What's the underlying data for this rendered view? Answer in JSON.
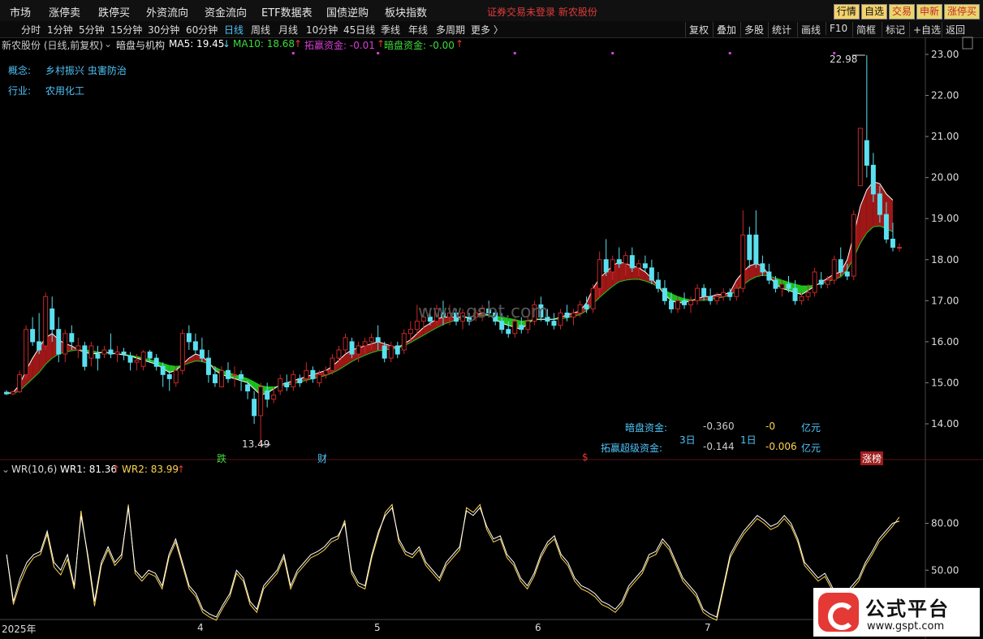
{
  "menu": {
    "items": [
      "市场",
      "涨停卖",
      "跌停买",
      "外资流向",
      "资金流向",
      "ETF数据表",
      "国债逆购",
      "板块指数"
    ],
    "notice": "证券交易未登录   新农股份",
    "right_buttons": [
      {
        "label": "行情",
        "bg": "#f5d36b",
        "fg": "#111"
      },
      {
        "label": "自选",
        "bg": "#f5d36b",
        "fg": "#111"
      },
      {
        "label": "交易",
        "bg": "#e9d66b",
        "fg": "#c62828"
      },
      {
        "label": "申新",
        "bg": "#e9d66b",
        "fg": "#c62828"
      },
      {
        "label": "涨停买",
        "bg": "#e9d66b",
        "fg": "#c62828"
      }
    ]
  },
  "periods": [
    "分时",
    "1分钟",
    "5分钟",
    "15分钟",
    "30分钟",
    "60分钟",
    "日线",
    "周线",
    "月线",
    "10分钟",
    "45日线",
    "季线",
    "年线",
    "多周期",
    "更多 〉"
  ],
  "active_period": "日线",
  "right_tools": [
    "复权",
    "叠加",
    "多股",
    "统计",
    "画线",
    "F10",
    "简框",
    "标记",
    "+自选",
    "返回"
  ],
  "title_line": {
    "stock": "新农股份 (日线,前复权)",
    "indicator": "暗盘与机构",
    "ma5": "MA5: 19.45",
    "ma10": "MA10: 18.68",
    "tuoying": "拓赢资金: -0.01",
    "anpan": "暗盘资金: -0.00"
  },
  "concept_label": "概念:",
  "concept_value": "乡村振兴  虫害防治",
  "industry_label": "行业:",
  "industry_value": "农用化工",
  "price_axis": [
    "23.00",
    "22.00",
    "21.00",
    "20.00",
    "19.00",
    "18.00",
    "17.00",
    "16.00",
    "15.00",
    "14.00"
  ],
  "high_label": "22.98",
  "low_label": "13.49",
  "watermark": "www.gsbt.com",
  "event_marks": {
    "die": "跌",
    "cai": "财",
    "s": "$",
    "zhang": "涨榜"
  },
  "fund_table": {
    "anpan_label": "暗盘资金:",
    "anpan_3d": "-0.360",
    "anpan_1d": "-0",
    "unit1": "亿元",
    "d3": "3日",
    "d1": "1日",
    "tuoying_label": "拓赢超级资金:",
    "tuoying_3d": "-0.144",
    "tuoying_1d": "-0.006",
    "unit2": "亿元"
  },
  "wr_line": {
    "name": "WR(10,6)",
    "wr1": "WR1: 81.36",
    "wr2": "WR2: 83.99"
  },
  "wr_axis": [
    "80.00",
    "50.00"
  ],
  "date_axis": [
    "2025年",
    "4",
    "5",
    "6",
    "7"
  ],
  "logo": {
    "title": "公式平台",
    "url": "www.gspt.com"
  },
  "colors": {
    "up": "#c62828",
    "down": "#5be0f0",
    "ma5": "#ffffff",
    "ma10": "#ffd54f",
    "band_green": "#1ec81e",
    "band_red": "#a51818",
    "wr1": "#ffffff",
    "wr2": "#ffd54f"
  },
  "chart_data": {
    "type": "candlestick",
    "ylim": [
      13.2,
      23.2
    ],
    "candles": [
      [
        14.77,
        14.82,
        14.7,
        14.73
      ],
      [
        14.73,
        14.8,
        14.7,
        14.78
      ],
      [
        14.78,
        15.3,
        14.75,
        15.2
      ],
      [
        15.2,
        16.4,
        15.1,
        16.3
      ],
      [
        16.3,
        16.6,
        15.9,
        16.0
      ],
      [
        16.0,
        16.7,
        15.7,
        15.8
      ],
      [
        15.9,
        17.2,
        15.8,
        17.1
      ],
      [
        16.8,
        17.1,
        16.0,
        16.3
      ],
      [
        16.3,
        16.6,
        15.5,
        15.7
      ],
      [
        15.7,
        16.3,
        15.5,
        16.2
      ],
      [
        16.2,
        16.4,
        15.8,
        16.0
      ],
      [
        15.8,
        16.1,
        15.6,
        15.9
      ],
      [
        15.9,
        16.0,
        15.3,
        15.4
      ],
      [
        15.6,
        16.0,
        15.4,
        15.9
      ],
      [
        15.7,
        15.9,
        15.3,
        15.6
      ],
      [
        15.7,
        15.9,
        15.6,
        15.8
      ],
      [
        15.8,
        16.2,
        15.6,
        15.7
      ],
      [
        15.7,
        15.9,
        15.5,
        15.75
      ],
      [
        15.75,
        15.85,
        15.55,
        15.7
      ],
      [
        15.65,
        15.75,
        15.3,
        15.5
      ],
      [
        15.5,
        15.7,
        15.3,
        15.55
      ],
      [
        15.4,
        15.8,
        15.3,
        15.75
      ],
      [
        15.75,
        15.8,
        15.5,
        15.6
      ],
      [
        15.6,
        15.7,
        15.3,
        15.4
      ],
      [
        15.4,
        15.5,
        14.9,
        15.2
      ],
      [
        15.2,
        15.3,
        14.8,
        15.1
      ],
      [
        15.0,
        15.4,
        14.9,
        15.3
      ],
      [
        15.3,
        16.3,
        15.2,
        16.2
      ],
      [
        16.2,
        16.4,
        15.8,
        16.0
      ],
      [
        16.0,
        16.2,
        15.7,
        15.8
      ],
      [
        15.8,
        16.1,
        15.5,
        15.6
      ],
      [
        15.6,
        15.8,
        15.0,
        15.2
      ],
      [
        15.2,
        15.4,
        14.9,
        15.0
      ],
      [
        14.9,
        15.4,
        14.9,
        15.3
      ],
      [
        15.3,
        15.5,
        15.0,
        15.1
      ],
      [
        15.2,
        15.4,
        14.9,
        15.2
      ],
      [
        15.2,
        15.3,
        14.8,
        15.1
      ],
      [
        14.95,
        15.05,
        14.6,
        14.8
      ],
      [
        14.6,
        14.8,
        14.0,
        14.2
      ],
      [
        14.2,
        15.0,
        13.49,
        14.9
      ],
      [
        14.8,
        15.0,
        14.4,
        14.6
      ],
      [
        14.6,
        14.9,
        14.5,
        14.7
      ],
      [
        14.8,
        15.2,
        14.7,
        15.1
      ],
      [
        15.0,
        15.2,
        14.8,
        14.9
      ],
      [
        14.9,
        15.3,
        14.8,
        15.2
      ],
      [
        15.1,
        15.2,
        14.9,
        15.0
      ],
      [
        15.1,
        15.5,
        15.0,
        15.3
      ],
      [
        15.3,
        15.4,
        15.0,
        15.1
      ],
      [
        15.0,
        15.3,
        14.9,
        15.2
      ],
      [
        15.2,
        15.4,
        15.1,
        15.3
      ],
      [
        15.3,
        15.7,
        15.2,
        15.6
      ],
      [
        15.6,
        15.9,
        15.5,
        15.8
      ],
      [
        15.8,
        16.2,
        15.7,
        16.1
      ],
      [
        16.0,
        16.1,
        15.6,
        15.7
      ],
      [
        15.7,
        16.0,
        15.5,
        15.9
      ],
      [
        15.9,
        16.1,
        15.7,
        16.0
      ],
      [
        16.0,
        16.2,
        15.8,
        16.1
      ],
      [
        16.1,
        16.4,
        15.8,
        16.0
      ],
      [
        15.9,
        16.0,
        15.5,
        15.6
      ],
      [
        15.6,
        16.0,
        15.5,
        15.9
      ],
      [
        15.9,
        16.0,
        15.6,
        15.7
      ],
      [
        15.8,
        16.3,
        15.7,
        16.2
      ],
      [
        16.2,
        16.5,
        16.0,
        16.3
      ],
      [
        16.3,
        16.9,
        16.2,
        16.5
      ],
      [
        16.5,
        16.8,
        16.3,
        16.6
      ],
      [
        16.6,
        16.8,
        16.4,
        16.5
      ],
      [
        16.5,
        16.9,
        16.4,
        16.8
      ],
      [
        16.7,
        17.0,
        16.4,
        16.6
      ],
      [
        16.6,
        16.9,
        16.4,
        16.7
      ],
      [
        16.7,
        16.8,
        16.4,
        16.5
      ],
      [
        16.5,
        16.8,
        16.3,
        16.7
      ],
      [
        16.6,
        16.7,
        16.4,
        16.5
      ],
      [
        16.6,
        16.8,
        16.5,
        16.7
      ],
      [
        16.7,
        16.9,
        16.5,
        16.8
      ],
      [
        16.8,
        17.0,
        16.6,
        16.7
      ],
      [
        16.7,
        16.8,
        16.4,
        16.5
      ],
      [
        16.5,
        16.7,
        16.2,
        16.3
      ],
      [
        16.3,
        16.5,
        16.1,
        16.2
      ],
      [
        16.2,
        16.6,
        16.1,
        16.5
      ],
      [
        16.4,
        16.6,
        16.2,
        16.3
      ],
      [
        16.3,
        16.6,
        16.2,
        16.5
      ],
      [
        16.5,
        17.0,
        16.4,
        16.9
      ],
      [
        16.9,
        17.1,
        16.5,
        16.6
      ],
      [
        16.6,
        16.8,
        16.4,
        16.5
      ],
      [
        16.5,
        16.7,
        16.3,
        16.4
      ],
      [
        16.4,
        16.8,
        16.3,
        16.7
      ],
      [
        16.7,
        16.9,
        16.5,
        16.6
      ],
      [
        16.6,
        16.8,
        16.4,
        16.7
      ],
      [
        16.7,
        17.0,
        16.6,
        16.9
      ],
      [
        16.9,
        17.1,
        16.7,
        16.8
      ],
      [
        16.8,
        17.4,
        16.7,
        17.3
      ],
      [
        17.3,
        18.2,
        17.1,
        18.0
      ],
      [
        18.0,
        18.5,
        17.6,
        17.7
      ],
      [
        17.7,
        18.1,
        17.5,
        18.0
      ],
      [
        18.0,
        18.3,
        17.8,
        17.9
      ],
      [
        17.9,
        18.2,
        17.6,
        18.1
      ],
      [
        18.1,
        18.3,
        17.7,
        17.8
      ],
      [
        17.8,
        18.0,
        17.6,
        17.9
      ],
      [
        17.9,
        18.1,
        17.7,
        17.8
      ],
      [
        17.8,
        18.0,
        17.4,
        17.5
      ],
      [
        17.5,
        17.7,
        17.2,
        17.3
      ],
      [
        17.3,
        17.5,
        16.9,
        17.0
      ],
      [
        17.0,
        17.2,
        16.7,
        16.8
      ],
      [
        16.8,
        17.1,
        16.7,
        17.0
      ],
      [
        17.0,
        17.2,
        16.8,
        16.9
      ],
      [
        16.9,
        17.1,
        16.7,
        17.0
      ],
      [
        17.0,
        17.4,
        16.9,
        17.3
      ],
      [
        17.3,
        17.4,
        17.0,
        17.1
      ],
      [
        17.1,
        17.3,
        16.9,
        17.0
      ],
      [
        17.0,
        17.2,
        16.9,
        17.1
      ],
      [
        17.1,
        17.3,
        17.0,
        17.2
      ],
      [
        17.2,
        17.3,
        17.0,
        17.1
      ],
      [
        17.1,
        17.4,
        17.0,
        17.3
      ],
      [
        17.3,
        19.2,
        17.2,
        18.6
      ],
      [
        18.6,
        18.8,
        17.8,
        18.0
      ],
      [
        18.6,
        19.2,
        17.8,
        17.9
      ],
      [
        17.9,
        18.1,
        17.6,
        17.7
      ],
      [
        17.7,
        17.9,
        17.4,
        17.5
      ],
      [
        17.5,
        17.6,
        17.2,
        17.3
      ],
      [
        17.3,
        17.5,
        17.1,
        17.4
      ],
      [
        17.4,
        17.6,
        17.2,
        17.3
      ],
      [
        17.3,
        17.5,
        16.9,
        17.0
      ],
      [
        17.0,
        17.2,
        16.9,
        17.1
      ],
      [
        17.1,
        17.4,
        17.0,
        17.2
      ],
      [
        17.2,
        17.8,
        17.1,
        17.7
      ],
      [
        17.5,
        17.7,
        17.3,
        17.4
      ],
      [
        17.4,
        17.6,
        17.3,
        17.5
      ],
      [
        17.5,
        18.1,
        17.4,
        18.0
      ],
      [
        18.0,
        18.3,
        17.6,
        17.7
      ],
      [
        17.7,
        17.9,
        17.5,
        17.6
      ],
      [
        17.6,
        19.2,
        17.5,
        19.1
      ],
      [
        19.8,
        21.2,
        19.8,
        21.2
      ],
      [
        20.9,
        22.98,
        20.0,
        20.3
      ],
      [
        20.3,
        20.6,
        19.4,
        19.6
      ],
      [
        19.6,
        19.8,
        18.9,
        19.1
      ],
      [
        19.1,
        19.4,
        18.4,
        18.5
      ],
      [
        18.5,
        18.9,
        18.2,
        18.3
      ],
      [
        18.3,
        18.4,
        18.2,
        18.3
      ]
    ],
    "ma5": [
      14.75,
      14.76,
      14.95,
      15.3,
      15.6,
      15.85,
      16.1,
      16.2,
      16.05,
      15.95,
      15.9,
      15.8,
      15.75,
      15.7,
      15.72,
      15.75,
      15.72,
      15.7,
      15.68,
      15.65,
      15.6,
      15.55,
      15.5,
      15.45,
      15.35,
      15.25,
      15.3,
      15.45,
      15.6,
      15.7,
      15.65,
      15.5,
      15.3,
      15.2,
      15.15,
      15.1,
      15.05,
      15.0,
      14.85,
      14.7,
      14.75,
      14.85,
      14.95,
      15.0,
      15.05,
      15.1,
      15.15,
      15.2,
      15.25,
      15.3,
      15.4,
      15.55,
      15.7,
      15.8,
      15.85,
      15.9,
      15.95,
      16.0,
      15.95,
      15.9,
      15.85,
      15.95,
      16.05,
      16.2,
      16.35,
      16.45,
      16.55,
      16.6,
      16.6,
      16.6,
      16.6,
      16.6,
      16.65,
      16.7,
      16.65,
      16.55,
      16.45,
      16.4,
      16.35,
      16.3,
      16.45,
      16.55,
      16.55,
      16.55,
      16.55,
      16.6,
      16.65,
      16.7,
      16.75,
      16.95,
      17.3,
      17.55,
      17.7,
      17.85,
      17.95,
      17.9,
      17.85,
      17.8,
      17.7,
      17.55,
      17.35,
      17.15,
      17.0,
      16.95,
      16.95,
      17.0,
      17.05,
      17.1,
      17.1,
      17.15,
      17.15,
      17.2,
      17.5,
      17.7,
      17.85,
      17.9,
      17.85,
      17.6,
      17.4,
      17.3,
      17.25,
      17.2,
      17.15,
      17.25,
      17.35,
      17.45,
      17.55,
      17.65,
      17.7,
      18.0,
      18.6,
      19.3,
      19.7,
      19.9,
      19.85,
      19.6,
      19.45
    ],
    "ma10": [
      14.74,
      14.74,
      14.8,
      14.95,
      15.1,
      15.25,
      15.45,
      15.6,
      15.7,
      15.75,
      15.78,
      15.8,
      15.8,
      15.78,
      15.75,
      15.73,
      15.72,
      15.71,
      15.69,
      15.67,
      15.64,
      15.6,
      15.56,
      15.52,
      15.47,
      15.42,
      15.4,
      15.42,
      15.48,
      15.53,
      15.52,
      15.46,
      15.38,
      15.3,
      15.25,
      15.2,
      15.15,
      15.1,
      15.02,
      14.93,
      14.9,
      14.9,
      14.92,
      14.95,
      14.98,
      15.02,
      15.06,
      15.1,
      15.14,
      15.18,
      15.24,
      15.32,
      15.42,
      15.52,
      15.6,
      15.67,
      15.73,
      15.78,
      15.8,
      15.82,
      15.84,
      15.9,
      15.98,
      16.07,
      16.16,
      16.25,
      16.34,
      16.42,
      16.48,
      16.53,
      16.57,
      16.6,
      16.62,
      16.64,
      16.64,
      16.62,
      16.6,
      16.57,
      16.54,
      16.5,
      16.52,
      16.54,
      16.54,
      16.54,
      16.54,
      16.56,
      16.58,
      16.62,
      16.66,
      16.76,
      16.92,
      17.08,
      17.22,
      17.35,
      17.46,
      17.5,
      17.52,
      17.52,
      17.48,
      17.42,
      17.34,
      17.25,
      17.17,
      17.1,
      17.05,
      17.02,
      17.01,
      17.01,
      17.03,
      17.06,
      17.09,
      17.13,
      17.25,
      17.38,
      17.5,
      17.58,
      17.62,
      17.6,
      17.55,
      17.5,
      17.45,
      17.4,
      17.36,
      17.36,
      17.38,
      17.42,
      17.46,
      17.52,
      17.58,
      17.75,
      18.05,
      18.4,
      18.65,
      18.8,
      18.82,
      18.75,
      18.68
    ]
  },
  "wr_data": {
    "ylim": [
      20,
      100
    ],
    "wr1": [
      60,
      30,
      45,
      55,
      60,
      62,
      75,
      55,
      50,
      60,
      40,
      85,
      60,
      30,
      55,
      65,
      55,
      60,
      90,
      50,
      45,
      50,
      48,
      40,
      60,
      70,
      55,
      40,
      35,
      25,
      22,
      20,
      28,
      35,
      50,
      45,
      30,
      25,
      40,
      45,
      50,
      60,
      40,
      50,
      55,
      60,
      62,
      65,
      70,
      72,
      80,
      50,
      42,
      40,
      60,
      75,
      85,
      90,
      70,
      62,
      60,
      65,
      55,
      50,
      45,
      55,
      60,
      65,
      88,
      85,
      90,
      78,
      70,
      72,
      60,
      55,
      45,
      40,
      48,
      60,
      68,
      72,
      60,
      55,
      45,
      40,
      38,
      35,
      30,
      28,
      25,
      30,
      40,
      45,
      50,
      60,
      62,
      70,
      65,
      55,
      45,
      40,
      35,
      25,
      22,
      20,
      40,
      60,
      68,
      75,
      80,
      85,
      82,
      78,
      80,
      85,
      80,
      70,
      55,
      50,
      45,
      48,
      40,
      30,
      35,
      40,
      45,
      55,
      62,
      70,
      75,
      80,
      81.36
    ],
    "wr2": [
      60,
      28,
      42,
      52,
      58,
      60,
      73,
      52,
      47,
      57,
      38,
      88,
      58,
      27,
      53,
      63,
      53,
      58,
      92,
      48,
      43,
      48,
      46,
      38,
      58,
      68,
      53,
      38,
      33,
      23,
      20,
      18,
      26,
      33,
      48,
      43,
      28,
      23,
      38,
      43,
      48,
      58,
      38,
      48,
      53,
      58,
      60,
      63,
      68,
      70,
      82,
      48,
      40,
      38,
      58,
      73,
      87,
      92,
      68,
      60,
      58,
      63,
      53,
      48,
      43,
      53,
      58,
      63,
      90,
      87,
      92,
      76,
      68,
      70,
      58,
      53,
      43,
      38,
      46,
      58,
      66,
      70,
      58,
      53,
      43,
      38,
      36,
      33,
      28,
      26,
      23,
      28,
      38,
      43,
      48,
      58,
      60,
      68,
      63,
      53,
      43,
      38,
      33,
      23,
      20,
      18,
      38,
      58,
      66,
      73,
      78,
      83,
      80,
      76,
      78,
      83,
      78,
      68,
      53,
      48,
      43,
      46,
      38,
      28,
      33,
      38,
      43,
      53,
      60,
      68,
      73,
      78,
      83.99
    ]
  }
}
